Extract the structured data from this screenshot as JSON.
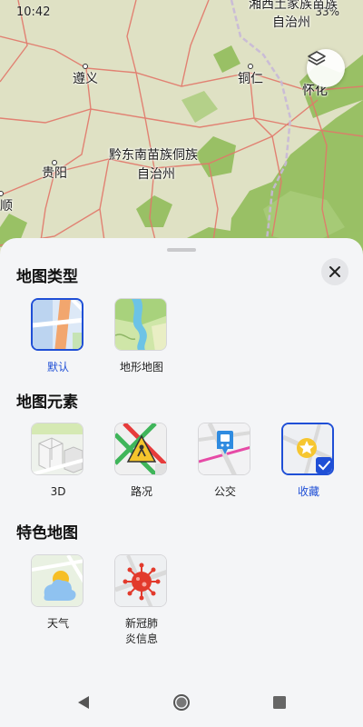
{
  "status": {
    "time": "10:42",
    "battery": "33%"
  },
  "map": {
    "labels": {
      "xiangxi": "湘西土家族苗族",
      "zizhizhou_top": "自治州",
      "zunyi": "遵义",
      "tongren": "铜仁",
      "huaihua": "怀化",
      "qiandongnan": "黔东南苗族侗族",
      "zizhizhou_mid": "自治州",
      "guiyang": "贵阳",
      "anshun": "顺"
    },
    "colors": {
      "base": "#dfe1c4",
      "forest": "#8dbb55",
      "road": "#e2776a",
      "border": "#c8b8d8"
    }
  },
  "sheet": {
    "sections": {
      "map_type": {
        "title": "地图类型",
        "options": [
          {
            "label": "默认",
            "selected": true
          },
          {
            "label": "地形地图",
            "selected": false
          }
        ]
      },
      "map_elements": {
        "title": "地图元素",
        "options": [
          {
            "label": "3D",
            "checked": false
          },
          {
            "label": "路况",
            "checked": false
          },
          {
            "label": "公交",
            "checked": false
          },
          {
            "label": "收藏",
            "checked": true
          }
        ]
      },
      "special_maps": {
        "title": "特色地图",
        "options": [
          {
            "label": "天气"
          },
          {
            "label": "新冠肺\n炎信息"
          }
        ]
      }
    },
    "accent_color": "#1f4fd6"
  },
  "icons": {
    "layer": "layers-icon",
    "close": "close-icon",
    "back": "back-triangle-icon",
    "home": "home-circle-icon",
    "recents": "recents-square-icon"
  }
}
